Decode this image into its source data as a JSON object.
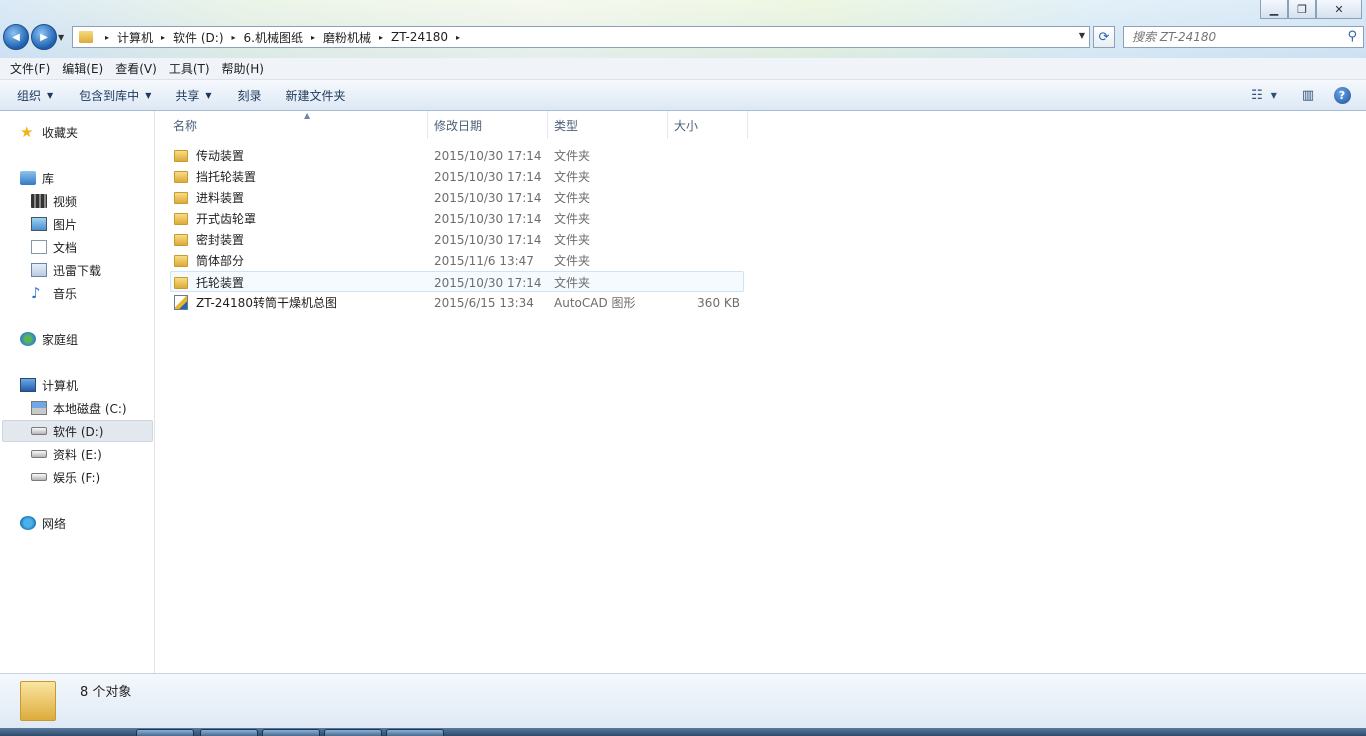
{
  "window": {
    "minimize_glyph": "▁",
    "maximize_glyph": "❐",
    "close_glyph": "✕"
  },
  "nav": {
    "back_glyph": "◀",
    "forward_glyph": "▶",
    "recent_glyph": "▼"
  },
  "address": {
    "crumbs": [
      "计算机",
      "软件 (D:)",
      "6.机械图纸",
      "磨粉机械",
      "ZT-24180"
    ],
    "separator": "▸",
    "dropdown_glyph": "▼",
    "refresh_glyph": "⟳"
  },
  "search": {
    "placeholder": "搜索 ZT-24180",
    "icon": "⚲"
  },
  "menu": [
    "文件(F)",
    "编辑(E)",
    "查看(V)",
    "工具(T)",
    "帮助(H)"
  ],
  "toolbar": {
    "organize": "组织",
    "include_library": "包含到库中",
    "share": "共享",
    "burn": "刻录",
    "new_folder": "新建文件夹",
    "dropdown_glyph": "▼",
    "view_glyph": "☷",
    "view_drop": "▼",
    "preview_glyph": "▥",
    "help_glyph": "?"
  },
  "sidebar": {
    "favorites": "收藏夹",
    "libraries": "库",
    "lib_items": [
      "视频",
      "图片",
      "文档",
      "迅雷下载",
      "音乐"
    ],
    "homegroup": "家庭组",
    "computer": "计算机",
    "drives": [
      "本地磁盘 (C:)",
      "软件 (D:)",
      "资料 (E:)",
      "娱乐 (F:)"
    ],
    "network": "网络",
    "selected": "软件 (D:)"
  },
  "columns": {
    "name": "名称",
    "modified": "修改日期",
    "type": "类型",
    "size": "大小",
    "sort_glyph": "▲"
  },
  "files": [
    {
      "name": "传动装置",
      "modified": "2015/10/30 17:14",
      "type": "文件夹",
      "size": ""
    },
    {
      "name": "挡托轮装置",
      "modified": "2015/10/30 17:14",
      "type": "文件夹",
      "size": ""
    },
    {
      "name": "进料装置",
      "modified": "2015/10/30 17:14",
      "type": "文件夹",
      "size": ""
    },
    {
      "name": "开式齿轮罩",
      "modified": "2015/10/30 17:14",
      "type": "文件夹",
      "size": ""
    },
    {
      "name": "密封装置",
      "modified": "2015/10/30 17:14",
      "type": "文件夹",
      "size": ""
    },
    {
      "name": "筒体部分",
      "modified": "2015/11/6 13:47",
      "type": "文件夹",
      "size": ""
    },
    {
      "name": "托轮装置",
      "modified": "2015/10/30 17:14",
      "type": "文件夹",
      "size": ""
    },
    {
      "name": "ZT-24180转筒干燥机总图",
      "modified": "2015/6/15 13:34",
      "type": "AutoCAD 图形",
      "size": "360 KB"
    }
  ],
  "status": {
    "count": "8 个对象"
  }
}
